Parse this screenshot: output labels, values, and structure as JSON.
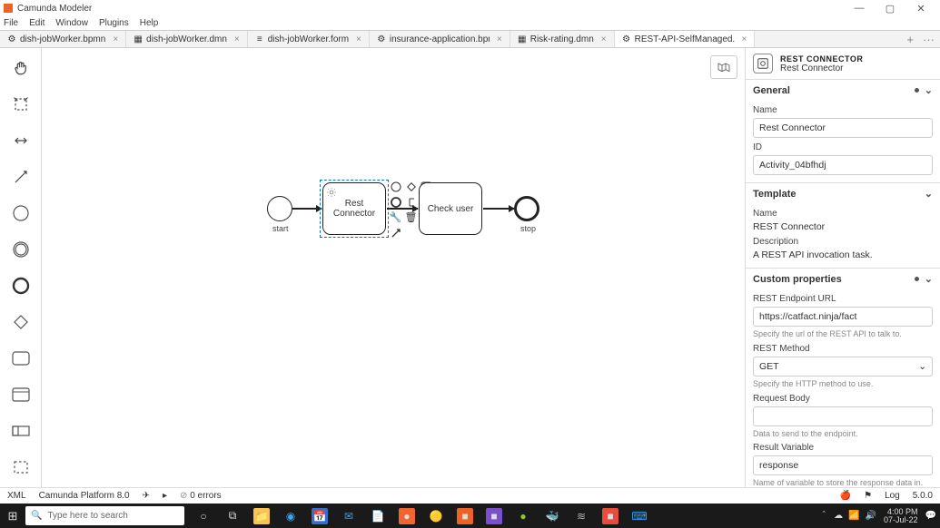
{
  "titlebar": {
    "app": "Camunda Modeler"
  },
  "menu": [
    "File",
    "Edit",
    "Window",
    "Plugins",
    "Help"
  ],
  "tabs": [
    {
      "label": "dish-jobWorker.bpmn",
      "icon": "gear"
    },
    {
      "label": "dish-jobWorker.dmn",
      "icon": "table"
    },
    {
      "label": "dish-jobWorker.form",
      "icon": "form"
    },
    {
      "label": "insurance-application.bpmn",
      "icon": "gear"
    },
    {
      "label": "Risk-rating.dmn",
      "icon": "table"
    },
    {
      "label": "REST-API-SelfManaged.bpmn",
      "icon": "gear",
      "active": true
    }
  ],
  "canvas": {
    "start_label": "start",
    "end_label": "stop",
    "task1": "Rest Connector",
    "task2": "Check user"
  },
  "props": {
    "header_line1": "REST CONNECTOR",
    "header_line2": "Rest Connector",
    "general": {
      "title": "General",
      "name_label": "Name",
      "name_value": "Rest Connector",
      "id_label": "ID",
      "id_value": "Activity_04bfhdj"
    },
    "template": {
      "title": "Template",
      "name_label": "Name",
      "name_value": "REST Connector",
      "desc_label": "Description",
      "desc_value": "A REST API invocation task."
    },
    "custom": {
      "title": "Custom properties",
      "url_label": "REST Endpoint URL",
      "url_value": "https://catfact.ninja/fact",
      "url_hint": "Specify the url of the REST API to talk to.",
      "method_label": "REST Method",
      "method_value": "GET",
      "method_hint": "Specify the HTTP method to use.",
      "body_label": "Request Body",
      "body_value": "",
      "body_hint": "Data to send to the endpoint.",
      "result_label": "Result Variable",
      "result_value": "response",
      "result_hint": "Name of variable to store the response data in."
    }
  },
  "status": {
    "xml": "XML",
    "platform": "Camunda Platform 8.0",
    "errors": "0 errors",
    "log": "Log",
    "version": "5.0.0"
  },
  "taskbar": {
    "search_placeholder": "Type here to search",
    "time": "4:00 PM",
    "date": "07-Jul-22"
  }
}
